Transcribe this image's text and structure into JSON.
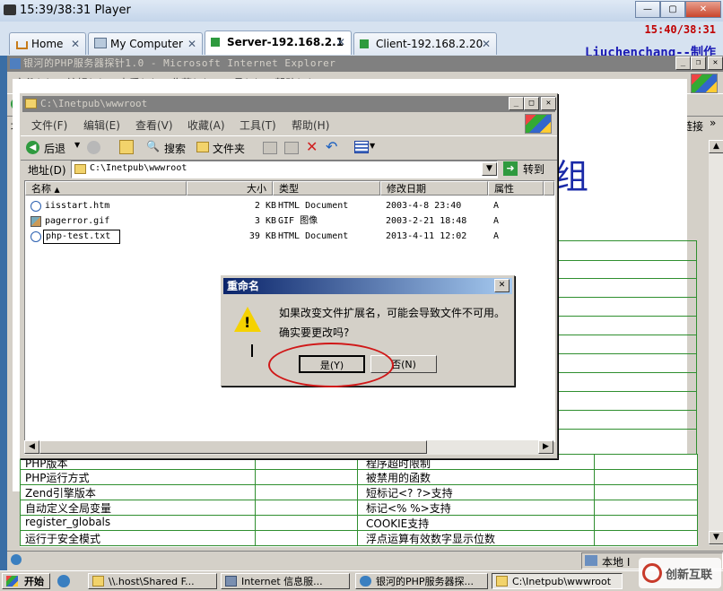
{
  "player": {
    "title": "15:39/38:31 Player"
  },
  "vm_tabs": [
    {
      "label": "Home"
    },
    {
      "label": "My Computer"
    },
    {
      "label": "Server-192.168.2.1"
    },
    {
      "label": "Client-192.168.2.20"
    }
  ],
  "overlay": {
    "clock": "15:40/38:31",
    "credit": "Liuchenchang--制作"
  },
  "ie": {
    "title": "银河的PHP服务器探针1.0 - Microsoft Internet Explorer",
    "menu": [
      "文件(F)",
      "编辑(E)",
      "查看(V)",
      "收藏(A)",
      "工具(T)",
      "帮助(H)"
    ],
    "goto_label": "转到",
    "links_label": "链接",
    "heading_fragment": "组",
    "status_zone": "本地 I"
  },
  "explorer": {
    "title": "C:\\Inetpub\\wwwroot",
    "menu": [
      "文件(F)",
      "编辑(E)",
      "查看(V)",
      "收藏(A)",
      "工具(T)",
      "帮助(H)"
    ],
    "toolbar": {
      "back": "后退",
      "search": "搜索",
      "folders": "文件夹"
    },
    "address_label": "地址(D)",
    "address_value": "C:\\Inetpub\\wwwroot",
    "goto_label": "转到",
    "columns": [
      "名称",
      "大小",
      "类型",
      "修改日期",
      "属性"
    ],
    "files": [
      {
        "name": "iisstart.htm",
        "size": "2 KB",
        "type": "HTML Document",
        "date": "2003-4-8 23:40",
        "attr": "A"
      },
      {
        "name": "pagerror.gif",
        "size": "3 KB",
        "type": "GIF 图像",
        "date": "2003-2-21 18:48",
        "attr": "A"
      },
      {
        "name": "php-test.txt",
        "size": "39 KB",
        "type": "HTML Document",
        "date": "2013-4-11 12:02",
        "attr": "A"
      }
    ]
  },
  "dialog": {
    "title": "重命名",
    "message_line1": "如果改变文件扩展名，可能会导致文件不可用。",
    "message_line2": "确实要更改吗?",
    "yes_label": "是(Y)",
    "no_label": "否(N)"
  },
  "page_table": {
    "left_col": [
      "PHP版本",
      "PHP运行方式",
      "Zend引擎版本",
      "自动定义全局变量",
      "register_globals",
      "运行于安全模式"
    ],
    "right_col": [
      "程序超时限制",
      "被禁用的函数",
      "短标记<? ?>支持",
      "标记<% %>支持",
      "COOKIE支持",
      "浮点运算有效数字显示位数"
    ]
  },
  "taskbar": {
    "start_label": "开始",
    "items": [
      {
        "label": "\\\\.host\\Shared F..."
      },
      {
        "label": "Internet 信息服..."
      },
      {
        "label": "银河的PHP服务器探..."
      },
      {
        "label": "C:\\Inetpub\\wwwroot"
      }
    ]
  },
  "watermark": "创新互联",
  "colors": {
    "accent_red": "#c00000",
    "credit_blue": "#1a1ab5",
    "dialog_title": "#0a246a",
    "table_green": "#2f8f2f"
  }
}
